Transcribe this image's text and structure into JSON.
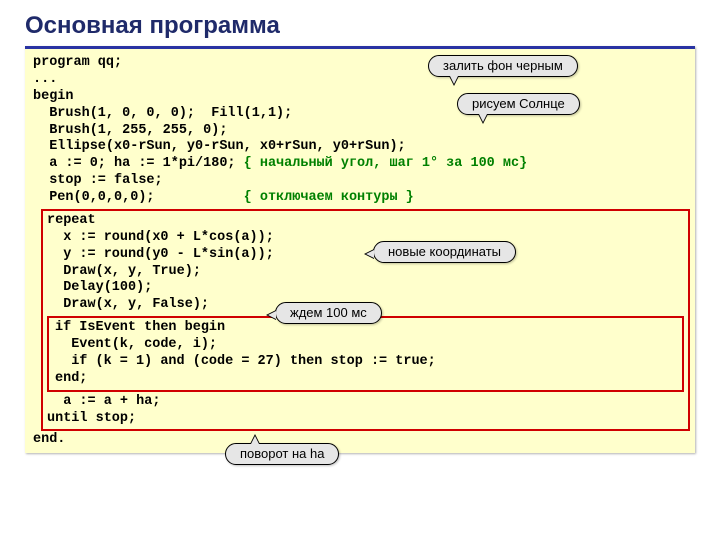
{
  "title": "Основная программа",
  "code": {
    "l1": "program qq;",
    "l2": "...",
    "l3": "begin",
    "l4": "  Brush(1, 0, 0, 0);  Fill(1,1);",
    "l5": "  Brush(1, 255, 255, 0);",
    "l6": "  Ellipse(x0-rSun, y0-rSun, x0+rSun, y0+rSun);",
    "l7a": "  a := 0; ha := 1*pi/180; ",
    "l7b": "{ начальный угол, шаг 1° за 100 мс}",
    "l8": "  stop := false;",
    "l9a": "  Pen(0,0,0,0);           ",
    "l9b": "{ отключаем контуры }",
    "r1": "repeat",
    "r2": "  x := round(x0 + L*cos(a));",
    "r3": "  y := round(y0 - L*sin(a));",
    "r4": "  Draw(x, y, True);",
    "r5": "  Delay(100);",
    "r6": "  Draw(x, y, False);",
    "i1": "if IsEvent then begin",
    "i2": "  Event(k, code, i);",
    "i3": "  if (k = 1) and (code = 27) then stop := true;",
    "i4": "end;",
    "r7": "  a := a + ha;",
    "r8": "until stop;",
    "l10": "end."
  },
  "callouts": {
    "c1": "залить фон черным",
    "c2": "рисуем Солнце",
    "c3": "новые координаты",
    "c4": "ждем 100 мс",
    "c5": "поворот на ha"
  }
}
